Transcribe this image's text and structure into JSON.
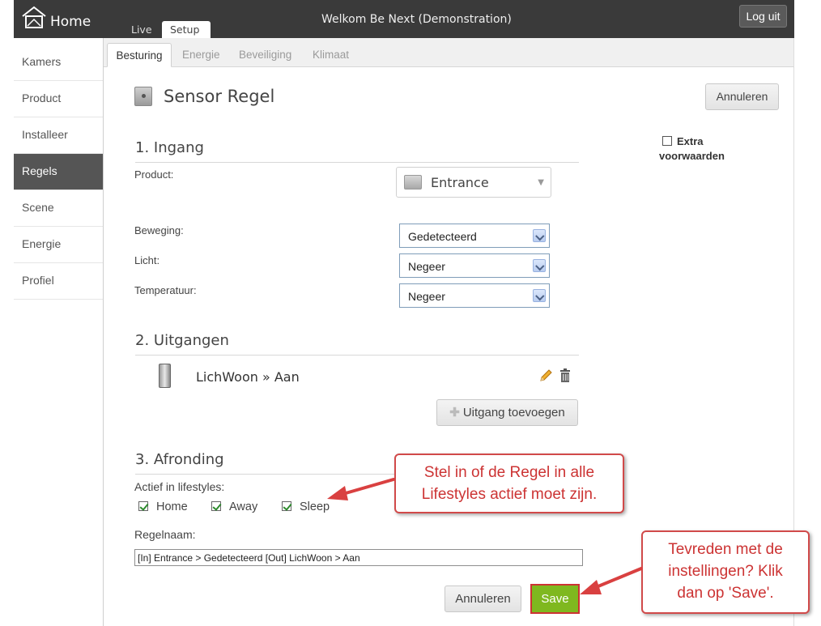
{
  "topbar": {
    "home_label": "Home",
    "tabs": [
      {
        "label": "Live"
      },
      {
        "label": "Setup"
      }
    ],
    "welcome": "Welkom Be Next (Demonstration)",
    "logout_label": "Log uit"
  },
  "sidebar": {
    "items": [
      {
        "label": "Kamers"
      },
      {
        "label": "Product"
      },
      {
        "label": "Installeer"
      },
      {
        "label": "Regels"
      },
      {
        "label": "Scene"
      },
      {
        "label": "Energie"
      },
      {
        "label": "Profiel"
      }
    ],
    "active_index": 3
  },
  "subtabs": [
    {
      "label": "Besturing"
    },
    {
      "label": "Energie"
    },
    {
      "label": "Beveiliging"
    },
    {
      "label": "Klimaat"
    }
  ],
  "header": {
    "title": "Sensor Regel",
    "cancel_label": "Annuleren"
  },
  "extra_conditions": {
    "line1": "Extra",
    "line2": "voorwaarden"
  },
  "input_section": {
    "title": "1. Ingang",
    "product_label": "Product:",
    "product_value": "Entrance",
    "fields": [
      {
        "label": "Beweging:",
        "value": "Gedetecteerd"
      },
      {
        "label": "Licht:",
        "value": "Negeer"
      },
      {
        "label": "Temperatuur:",
        "value": "Negeer"
      }
    ]
  },
  "output_section": {
    "title": "2. Uitgangen",
    "output_label": "LichWoon » Aan",
    "add_label": "Uitgang toevoegen",
    "add_icon": "plus-icon"
  },
  "finish_section": {
    "title": "3. Afronding",
    "lifestyles_label": "Actief in lifestyles:",
    "lifestyles": [
      {
        "label": "Home",
        "checked": true
      },
      {
        "label": "Away",
        "checked": true
      },
      {
        "label": "Sleep",
        "checked": true
      }
    ],
    "name_label": "Regelnaam:",
    "name_value": "[In] Entrance > Gedetecteerd  [Out] LichWoon > Aan",
    "cancel_label": "Annuleren",
    "save_label": "Save"
  },
  "callouts": {
    "lifestyles": {
      "line1": "Stel in of de Regel in alle",
      "line2": "Lifestyles actief moet zijn."
    },
    "save": {
      "line1": "Tevreden met de",
      "line2": "instellingen? Klik",
      "line3": "dan op 'Save'."
    }
  },
  "colors": {
    "topbar": "#3a3a3a",
    "sidebar_active": "#555555",
    "save_button": "#7fb81f",
    "callout_red": "#cc3333"
  }
}
